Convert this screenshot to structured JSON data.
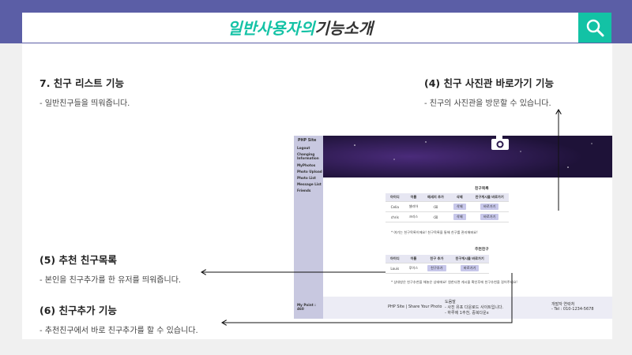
{
  "header": {
    "title_accent": "일반사용자의",
    "title_rest": "기능소개"
  },
  "sections": {
    "s7": {
      "title": "7. 친구 리스트 기능",
      "desc": "-  일반친구들을 띄워줍니다."
    },
    "s4": {
      "title": "(4) 친구 사진관 바로가기 기능",
      "desc": "-  친구의 사진관을 방문할 수 있습니다."
    },
    "s5": {
      "title": "(5) 추천 친구목록",
      "desc": "-  본인을 친구추가를 한 유저를 띄워줍니다."
    },
    "s6": {
      "title": "(6) 친구추가 기능",
      "desc": "-  추천친구에서 바로 친구추가를 할 수 있습니다."
    }
  },
  "screenshot": {
    "site_name": "PHP Site",
    "sidebar": [
      "Logout",
      "Changing Information",
      "MyPhotos",
      "Photo Upload",
      "Photo List",
      "Message List",
      "Friends"
    ],
    "point_label": "My Point : 460",
    "friends": {
      "heading": "친구목록",
      "columns": [
        "아이디",
        "이름",
        "메세지 추가",
        "삭제",
        "친구게시물 바로가기"
      ],
      "rows": [
        {
          "id": "Celia",
          "name": "셀리아",
          "msg": "⌫",
          "del": "삭제",
          "go": "바로가기"
        },
        {
          "id": "chris",
          "name": "크리스",
          "msg": "⌫",
          "del": "삭제",
          "go": "바로가기"
        }
      ],
      "note": "* 여기는 친구목록이에요! 친구목록을 통해 친구를 관리해봐요!"
    },
    "recommend": {
      "heading": "추천친구",
      "columns": [
        "아이디",
        "이름",
        "친구 추가",
        "친구게시물 바로가기"
      ],
      "rows": [
        {
          "id": "Louis",
          "name": "루이스",
          "add": "친구추가",
          "go": "바로가기"
        }
      ],
      "note": "* 상대방은 친구추천을 해놓은 상태에요! 원한다면 게시물 확인후에 친구추천을 걸어주세요!"
    },
    "footer": {
      "brand": "PHP Site | Share Your Photo",
      "help_title": "도움말",
      "help_1": "- 사진 유포 다운로드 사이트입니다.",
      "help_2": "- 하루에 1추천, 중복다운x",
      "dev_title": "개발자 연락처",
      "dev_tel": "- Tel : 010-1234-5678"
    }
  },
  "colors": {
    "accent": "#13c2a5",
    "frame": "#5b5ea6"
  }
}
